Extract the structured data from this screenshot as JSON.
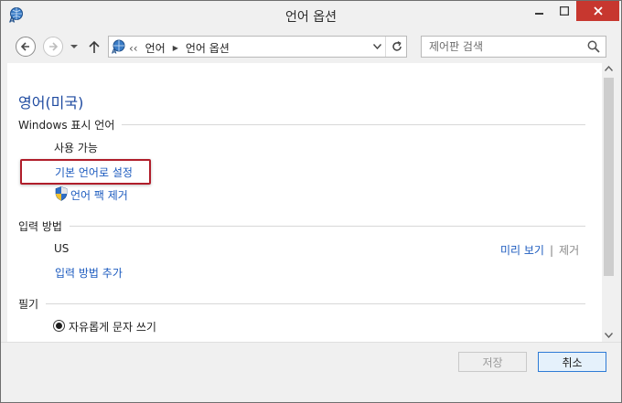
{
  "window": {
    "title": "언어 옵션"
  },
  "address": {
    "prefix": "‹‹",
    "crumbs": [
      "언어",
      "언어 옵션"
    ],
    "separator": "›"
  },
  "search": {
    "placeholder": "제어판 검색"
  },
  "content": {
    "language_name": "영어(미국)",
    "display_language": {
      "heading": "Windows 표시 언어",
      "status": "사용 가능",
      "set_default_link": "기본 언어로 설정",
      "remove_pack_link": "언어 팩 제거"
    },
    "input_method": {
      "heading": "입력 방법",
      "method_name": "US",
      "preview_link": "미리 보기",
      "divider": "|",
      "remove_label": "제거",
      "add_link": "입력 방법 추가"
    },
    "handwriting": {
      "heading": "필기",
      "option_label": "자유롭게 문자 쓰기",
      "option_selected": true
    }
  },
  "footer": {
    "save_label": "저장",
    "cancel_label": "취소"
  },
  "colors": {
    "link": "#1c5bbf",
    "title_blue": "#1e4aa0",
    "highlight_border": "#b01d2a",
    "close_button": "#c7372f"
  },
  "icons": {
    "app": "language-globe-icon",
    "shield": "uac-shield-icon"
  }
}
